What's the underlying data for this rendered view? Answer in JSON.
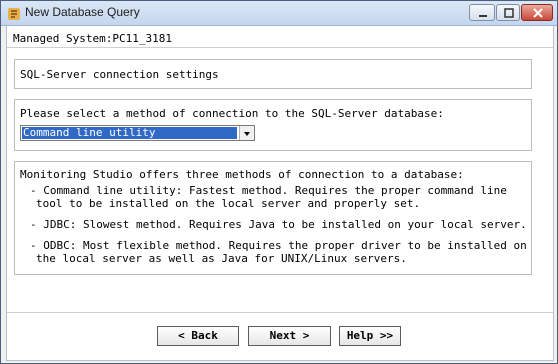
{
  "window": {
    "title": "New Database Query"
  },
  "header": {
    "managed_system": "Managed System:PC11_3181"
  },
  "section1": {
    "title": "SQL-Server connection settings"
  },
  "section2": {
    "prompt": "Please select a method of connection to the SQL-Server database:",
    "select_value": "Command line utility"
  },
  "section3": {
    "intro": "Monitoring Studio offers three methods of connection to a database:",
    "bullet1_line1": "- Command line utility: Fastest method. Requires the proper command line",
    "bullet1_line2": "tool to be installed on the local server and properly set.",
    "bullet2": "- JDBC: Slowest method. Requires Java to be installed on your local server.",
    "bullet3_line1": "- ODBC: Most flexible method. Requires the proper driver to be installed on",
    "bullet3_line2": "the local server as well as Java for UNIX/Linux servers."
  },
  "buttons": {
    "back": "< Back",
    "next": "Next >",
    "help": "Help >>"
  },
  "icons": {
    "app": "app-icon",
    "minimize": "minimize-icon",
    "maximize": "maximize-icon",
    "close": "close-icon",
    "dropdown": "chevron-down-icon"
  }
}
